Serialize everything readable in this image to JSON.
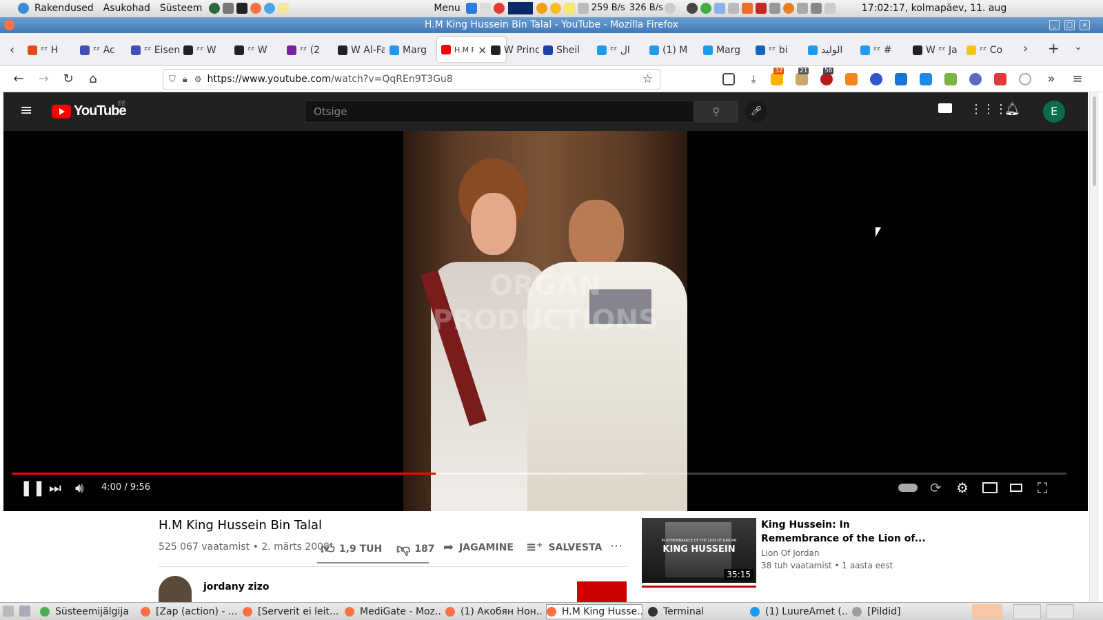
{
  "top_panel": {
    "menu_apps": "Rakendused",
    "menu_places": "Asukohad",
    "menu_system": "Süsteem",
    "menu_label": "Menu",
    "net_down": "259 B/s",
    "net_up": "326 B/s",
    "clock": "17:02:17, kolmapäev, 11. aug"
  },
  "window": {
    "title": "H.M King Hussein Bin Talal - YouTube - Mozilla Firefox"
  },
  "tabs": [
    {
      "label": "ᶻᶻ H",
      "color": "#e64a19"
    },
    {
      "label": "ᶻᶻ Ac",
      "color": "#3f51b5"
    },
    {
      "label": "ᶻᶻ Eisen",
      "color": "#3f51b5"
    },
    {
      "label": "ᶻᶻ W",
      "color": "#222222"
    },
    {
      "label": "ᶻᶻ W",
      "color": "#222222"
    },
    {
      "label": "ᶻᶻ (2",
      "color": "#7b1fa2"
    },
    {
      "label": "W Al-Fa",
      "color": "#222222"
    },
    {
      "label": "Marg",
      "color": "#1d9bf0"
    },
    {
      "label": "H.M PLA",
      "color": "#ff0000"
    },
    {
      "label": "W Princ",
      "color": "#222222"
    },
    {
      "label": "Sheil",
      "color": "#1e40af"
    },
    {
      "label": "ᶻᶻ ال",
      "color": "#1d9bf0"
    },
    {
      "label": "(1) M",
      "color": "#1d9bf0"
    },
    {
      "label": "Marg",
      "color": "#1d9bf0"
    },
    {
      "label": "ᶻᶻ bi",
      "color": "#1565c0"
    },
    {
      "label": "الوليد",
      "color": "#1d9bf0"
    },
    {
      "label": "ᶻᶻ #",
      "color": "#1d9bf0"
    },
    {
      "label": "W ᶻᶻ Ja",
      "color": "#222222"
    },
    {
      "label": "ᶻᶻ Co",
      "color": "#f5c518"
    }
  ],
  "nav": {
    "url_host": "https://www.youtube.com",
    "url_path": "/watch?v=QqREn9T3Gu8",
    "badge_1": "32",
    "badge_2": "21",
    "badge_3": "56"
  },
  "youtube": {
    "logo": "YouTube",
    "country": "EE",
    "search_placeholder": "Otsige",
    "avatar_letter": "E",
    "player": {
      "time": "4:00 / 9:56",
      "progress_fraction": 0.402,
      "buffered_fraction": 0.6,
      "watermark": "ORGAN PRODUCTIONS"
    },
    "video": {
      "title": "H.M King Hussein Bin Talal",
      "meta": "525 067 vaatamist • 2. märts 2008",
      "likes": "1,9 TUH",
      "dislikes": "187",
      "share": "JAGAMINE",
      "save": "SALVESTA",
      "channel": "jordany zizo"
    },
    "related": {
      "title_line1": "King Hussein: In",
      "title_line2": "Remembrance of the Lion of...",
      "channel": "Lion Of Jordan",
      "meta": "38 tuh vaatamist • 1 aasta eest",
      "duration": "35:15",
      "thumb_text": "KING HUSSEIN",
      "thumb_caption": "IN REMEMBRANCE OF THE LION OF JORDAN"
    }
  },
  "taskbar": {
    "items": [
      {
        "label": "Süsteemijälgija",
        "color": "#4caf50"
      },
      {
        "label": "[Zap (action) - ...",
        "color": "#ff7043"
      },
      {
        "label": "[Serverit ei leit...",
        "color": "#ff7043"
      },
      {
        "label": "MediGate - Moz...",
        "color": "#ff7043"
      },
      {
        "label": "(1) Акобян Нон...",
        "color": "#ff7043"
      },
      {
        "label": "H.M King Husse...",
        "color": "#ff7043"
      },
      {
        "label": "Terminal",
        "color": "#333333"
      },
      {
        "label": "(1) LuureAmet (...",
        "color": "#1d9bf0"
      },
      {
        "label": "[Pildid]",
        "color": "#9e9e9e"
      }
    ]
  }
}
